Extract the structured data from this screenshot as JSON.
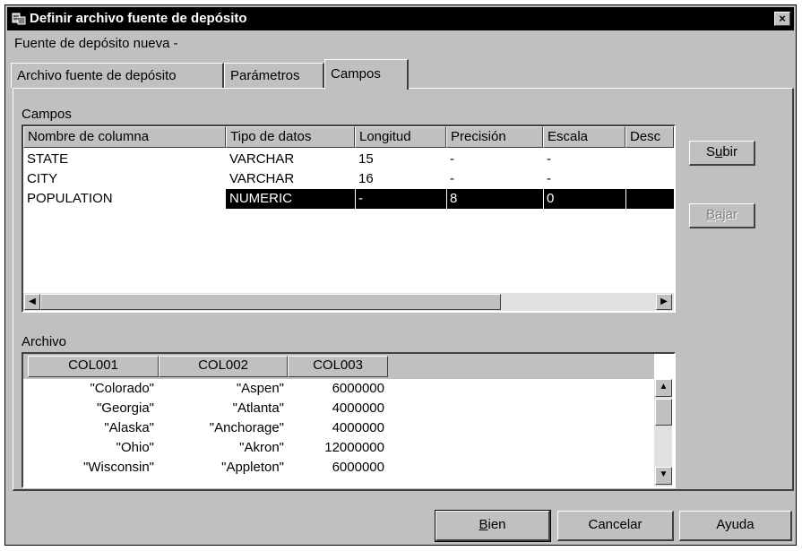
{
  "window": {
    "title": "Definir archivo fuente de depósito",
    "close_label": "×",
    "subtitle": "Fuente de depósito nueva -"
  },
  "tabs": [
    {
      "label": "Archivo fuente de depósito",
      "active": false
    },
    {
      "label": "Parámetros",
      "active": false
    },
    {
      "label": "Campos",
      "active": true
    }
  ],
  "campos": {
    "section_label": "Campos",
    "columns": [
      "Nombre de columna",
      "Tipo de datos",
      "Longitud",
      "Precisión",
      "Escala",
      "Desc"
    ],
    "rows": [
      [
        "STATE",
        "VARCHAR",
        "15",
        "-",
        "-",
        ""
      ],
      [
        "CITY",
        "VARCHAR",
        "16",
        "-",
        "-",
        ""
      ],
      [
        "POPULATION",
        "NUMERIC",
        "-",
        "8",
        "0",
        ""
      ]
    ],
    "selected_row": 2
  },
  "side_buttons": {
    "up": {
      "prefix": "S",
      "accel": "u",
      "rest": "bir"
    },
    "down": {
      "prefix": "",
      "accel": "B",
      "rest": "ajar"
    }
  },
  "archivo": {
    "section_label": "Archivo",
    "columns": [
      "COL001",
      "COL002",
      "COL003"
    ],
    "rows": [
      [
        "\"Colorado\"",
        "\"Aspen\"",
        "6000000"
      ],
      [
        "\"Georgia\"",
        "\"Atlanta\"",
        "4000000"
      ],
      [
        "\"Alaska\"",
        "\"Anchorage\"",
        "4000000"
      ],
      [
        "\"Ohio\"",
        "\"Akron\"",
        "12000000"
      ],
      [
        "\"Wisconsin\"",
        "\"Appleton\"",
        "6000000"
      ]
    ]
  },
  "footer": {
    "ok": {
      "accel": "B",
      "rest": "ien"
    },
    "cancel": "Cancelar",
    "help": "Ayuda"
  }
}
